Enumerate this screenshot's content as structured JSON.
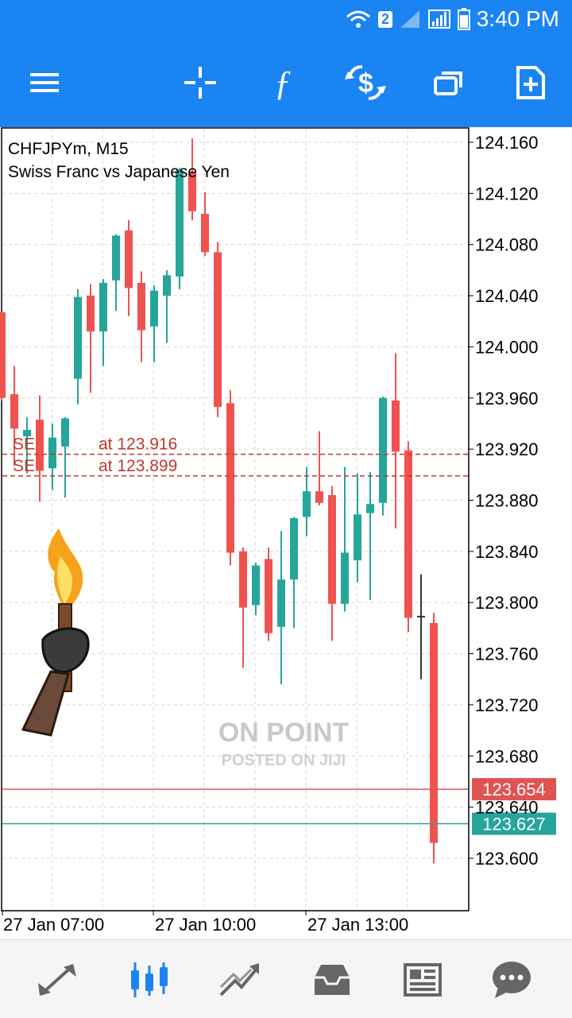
{
  "status": {
    "time": "3:40 PM",
    "sim_badge": "2"
  },
  "toolbar": {
    "icons": [
      "menu-icon",
      "crosshair-icon",
      "function-icon",
      "currency-swap-icon",
      "windows-icon",
      "new-document-icon"
    ]
  },
  "chart_data": {
    "type": "candlestick",
    "title": "CHFJPYm, M15",
    "subtitle": "Swiss Franc vs Japanese Yen",
    "ylim": [
      123.56,
      124.17
    ],
    "y_ticks": [
      "124.160",
      "124.120",
      "124.080",
      "124.040",
      "124.000",
      "123.960",
      "123.920",
      "123.880",
      "123.840",
      "123.800",
      "123.760",
      "123.720",
      "123.680",
      "123.640",
      "123.600"
    ],
    "x_ticks": [
      "27 Jan 07:00",
      "27 Jan 10:00",
      "27 Jan 13:00"
    ],
    "up_color": "#26a69a",
    "down_color": "#ef5350",
    "candles": [
      {
        "o": 124.027,
        "h": 124.027,
        "l": 123.958,
        "c": 123.96
      },
      {
        "o": 123.963,
        "h": 123.985,
        "l": 123.907,
        "c": 123.936
      },
      {
        "o": 123.93,
        "h": 123.945,
        "l": 123.901,
        "c": 123.935
      },
      {
        "o": 123.943,
        "h": 123.962,
        "l": 123.879,
        "c": 123.903
      },
      {
        "o": 123.905,
        "h": 123.94,
        "l": 123.888,
        "c": 123.929
      },
      {
        "o": 123.922,
        "h": 123.945,
        "l": 123.882,
        "c": 123.944
      },
      {
        "o": 123.975,
        "h": 124.045,
        "l": 123.955,
        "c": 124.039
      },
      {
        "o": 124.04,
        "h": 124.049,
        "l": 123.964,
        "c": 124.012
      },
      {
        "o": 124.012,
        "h": 124.053,
        "l": 123.985,
        "c": 124.05
      },
      {
        "o": 124.052,
        "h": 124.088,
        "l": 124.028,
        "c": 124.087
      },
      {
        "o": 124.091,
        "h": 124.099,
        "l": 124.024,
        "c": 124.046
      },
      {
        "o": 124.05,
        "h": 124.059,
        "l": 123.988,
        "c": 124.013
      },
      {
        "o": 124.016,
        "h": 124.048,
        "l": 123.988,
        "c": 124.044
      },
      {
        "o": 124.04,
        "h": 124.06,
        "l": 124.003,
        "c": 124.056
      },
      {
        "o": 124.055,
        "h": 124.14,
        "l": 124.045,
        "c": 124.138
      },
      {
        "o": 124.136,
        "h": 124.163,
        "l": 124.099,
        "c": 124.106
      },
      {
        "o": 124.104,
        "h": 124.121,
        "l": 124.071,
        "c": 124.074
      },
      {
        "o": 124.074,
        "h": 124.082,
        "l": 123.945,
        "c": 123.953
      },
      {
        "o": 123.956,
        "h": 123.966,
        "l": 123.829,
        "c": 123.839
      },
      {
        "o": 123.84,
        "h": 123.843,
        "l": 123.749,
        "c": 123.796
      },
      {
        "o": 123.798,
        "h": 123.831,
        "l": 123.79,
        "c": 123.829
      },
      {
        "o": 123.834,
        "h": 123.843,
        "l": 123.77,
        "c": 123.776
      },
      {
        "o": 123.781,
        "h": 123.856,
        "l": 123.736,
        "c": 123.818
      },
      {
        "o": 123.818,
        "h": 123.867,
        "l": 123.78,
        "c": 123.866
      },
      {
        "o": 123.867,
        "h": 123.906,
        "l": 123.852,
        "c": 123.887
      },
      {
        "o": 123.887,
        "h": 123.934,
        "l": 123.876,
        "c": 123.878
      },
      {
        "o": 123.884,
        "h": 123.891,
        "l": 123.77,
        "c": 123.799
      },
      {
        "o": 123.799,
        "h": 123.906,
        "l": 123.793,
        "c": 123.839
      },
      {
        "o": 123.833,
        "h": 123.901,
        "l": 123.816,
        "c": 123.869
      },
      {
        "o": 123.87,
        "h": 123.902,
        "l": 123.802,
        "c": 123.877
      },
      {
        "o": 123.878,
        "h": 123.961,
        "l": 123.868,
        "c": 123.96
      },
      {
        "o": 123.958,
        "h": 123.995,
        "l": 123.858,
        "c": 123.918
      },
      {
        "o": 123.919,
        "h": 123.926,
        "l": 123.777,
        "c": 123.788
      },
      {
        "o": 123.789,
        "h": 123.822,
        "l": 123.74,
        "c": 123.789
      },
      {
        "o": 123.784,
        "h": 123.792,
        "l": 123.596,
        "c": 123.612
      }
    ],
    "order_lines": [
      {
        "text": "SELL 0.01 at 123.916",
        "price": 123.916,
        "label": "SE",
        "label_price": "at 123.916"
      },
      {
        "text": "SELL 0.01 at 123.899",
        "price": 123.899,
        "label": "SE",
        "label_price": "at 123.899"
      }
    ],
    "price_lines": [
      {
        "price": 123.654,
        "label": "123.654",
        "color": "#e05353"
      },
      {
        "price": 123.627,
        "label": "123.627",
        "color": "#26a69a"
      }
    ]
  },
  "watermark": {
    "line1": "ON POINT",
    "line2": "POSTED ON JIJI"
  },
  "bottom_nav": {
    "icons": [
      "quotes-icon",
      "chart-icon",
      "trade-icon",
      "history-icon",
      "news-icon",
      "chat-icon"
    ],
    "active": 1
  }
}
